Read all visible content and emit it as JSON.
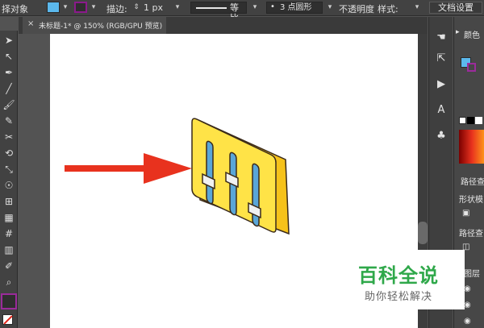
{
  "control_bar": {
    "selection_label": "择对象",
    "stroke_label": "描边:",
    "stroke_weight": "1 px",
    "profile_label": "等比",
    "brush_label": "3 点圆形",
    "opacity_label": "不透明度",
    "style_label": "样式:",
    "doc_setup_label": "文档设置",
    "fill_color": "#5bb8ec",
    "stroke_color": "#8b1a8b"
  },
  "document_tab": {
    "close": "×",
    "title": "未标题-1* @ 150% (RGB/GPU 预览)"
  },
  "tools": [
    "selection-icon",
    "direct-selection-icon",
    "pen-icon",
    "line-icon",
    "brush-icon",
    "pencil-icon",
    "scissors-icon",
    "rotate-icon",
    "scale-icon",
    "warp-icon",
    "shape-builder-icon",
    "gradient-icon",
    "mesh-icon",
    "graph-icon",
    "eyedropper-icon",
    "zoom-icon"
  ],
  "panels": {
    "color_label": "颜色",
    "pathfinder_label": "路径查",
    "shape_mode_label": "形状模",
    "pathfinder2_label": "路径查",
    "layers_label": "图层"
  },
  "artwork": {
    "arrow_color": "#e8321e",
    "icon_face": "#ffe347",
    "icon_side": "#f6c21a",
    "outline": "#3a2a1a",
    "slot_fill": "#5aa6d8",
    "knob_fill": "#f1f1f1"
  },
  "watermark": {
    "title": "百科全说",
    "subtitle": "助你轻松解决"
  }
}
